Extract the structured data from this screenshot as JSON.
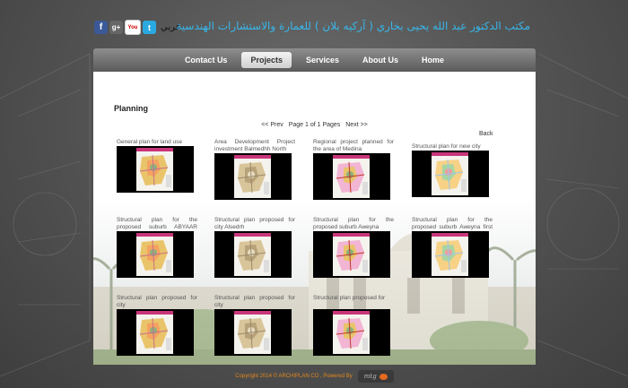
{
  "header": {
    "title": "مكتب الدكتور عبد الله يحيى بخاري ( آركيه بلان ) للعمارة والاستشارات الهندسية",
    "language_link": "عربي",
    "social": [
      {
        "icon": "facebook-icon",
        "glyph": "f"
      },
      {
        "icon": "google-plus-icon",
        "glyph": "g+"
      },
      {
        "icon": "youtube-icon",
        "glyph": "You"
      },
      {
        "icon": "twitter-icon",
        "glyph": "t"
      }
    ]
  },
  "nav": {
    "items": [
      "Contact Us",
      "Projects",
      "Services",
      "About Us",
      "Home"
    ],
    "active": "Projects"
  },
  "main": {
    "title": "Planning",
    "pager": {
      "prev": "<< Prev",
      "status": "Page 1 of 1 Pages",
      "next": "Next >>"
    },
    "back": "Back",
    "projects": [
      {
        "caption": "General plan for land use"
      },
      {
        "caption": "Area Development Project investment Balmedhh North"
      },
      {
        "caption": "Regional project planned for the area of Medina"
      },
      {
        "caption": "Structural plan for new city"
      },
      {
        "caption": "Structural plan for the proposed suburb ABYAAR Walker"
      },
      {
        "caption": "Structural plan proposed for city Alsedrh"
      },
      {
        "caption": "Structural plan for the proposed suburb Aweyna"
      },
      {
        "caption": "Structural plan for the proposed suburb Aweyna first alternative"
      },
      {
        "caption": "Structural plan proposed for city"
      },
      {
        "caption": "Structural plan proposed for city"
      },
      {
        "caption": "Structural plan proposed for"
      }
    ]
  },
  "footer": {
    "text": "Copyright 2014 © ARCHIPLAN CO , Powered By",
    "logo_text": "mtg"
  },
  "colors": {
    "accent": "#38b6ea",
    "footer": "#e3871e",
    "nav": "#6e6e6e"
  }
}
